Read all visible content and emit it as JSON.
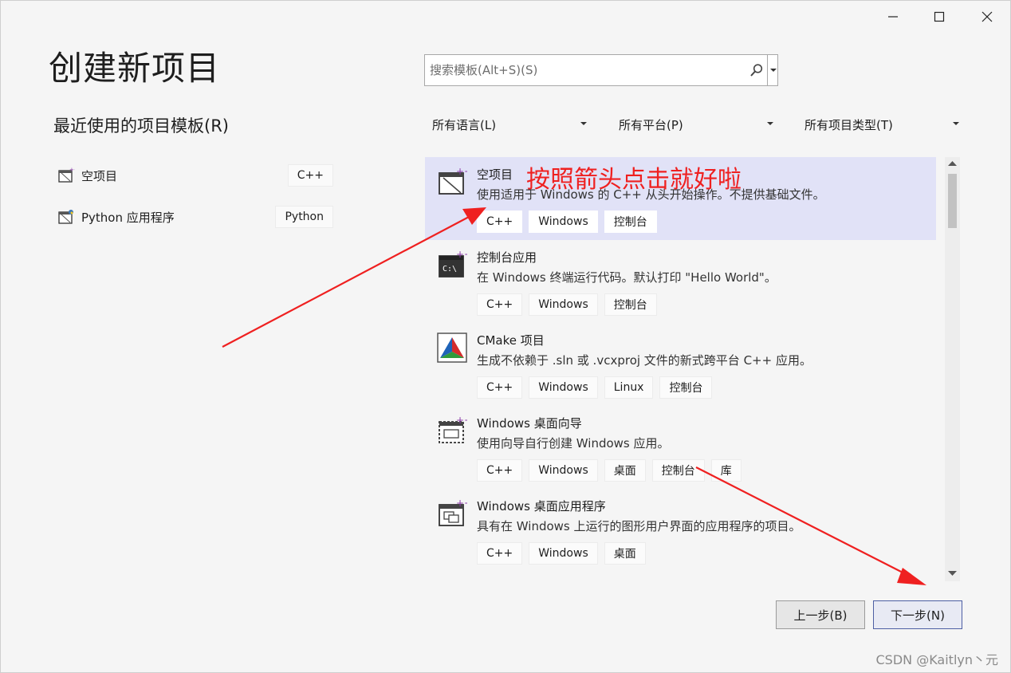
{
  "window": {
    "controls": [
      "minimize",
      "maximize",
      "close"
    ]
  },
  "page": {
    "title": "创建新项目"
  },
  "recent": {
    "title": "最近使用的项目模板(R)",
    "items": [
      {
        "label": "空项目",
        "tag": "C++",
        "icon": "empty-project-icon"
      },
      {
        "label": "Python 应用程序",
        "tag": "Python",
        "icon": "python-app-icon"
      }
    ]
  },
  "search": {
    "placeholder": "搜索模板(Alt+S)(S)",
    "value": ""
  },
  "filters": {
    "language": "所有语言(L)",
    "platform": "所有平台(P)",
    "project_type": "所有项目类型(T)"
  },
  "templates": [
    {
      "name": "空项目",
      "description": "使用适用于 Windows 的 C++ 从头开始操作。不提供基础文件。",
      "tags": [
        "C++",
        "Windows",
        "控制台"
      ],
      "icon": "empty-project-icon",
      "selected": true
    },
    {
      "name": "控制台应用",
      "description": "在 Windows 终端运行代码。默认打印 \"Hello World\"。",
      "tags": [
        "C++",
        "Windows",
        "控制台"
      ],
      "icon": "console-app-icon",
      "selected": false
    },
    {
      "name": "CMake 项目",
      "description": "生成不依赖于 .sln 或 .vcxproj 文件的新式跨平台 C++ 应用。",
      "tags": [
        "C++",
        "Windows",
        "Linux",
        "控制台"
      ],
      "icon": "cmake-icon",
      "selected": false
    },
    {
      "name": "Windows 桌面向导",
      "description": "使用向导自行创建 Windows 应用。",
      "tags": [
        "C++",
        "Windows",
        "桌面",
        "控制台",
        "库"
      ],
      "icon": "desktop-wizard-icon",
      "selected": false
    },
    {
      "name": "Windows 桌面应用程序",
      "description": "具有在 Windows 上运行的图形用户界面的应用程序的项目。",
      "tags": [
        "C++",
        "Windows",
        "桌面"
      ],
      "icon": "desktop-app-icon",
      "selected": false
    }
  ],
  "buttons": {
    "back": "上一步(B)",
    "next": "下一步(N)"
  },
  "annotation": {
    "text": "按照箭头点击就好啦",
    "color": "#ef2020"
  },
  "watermark": "CSDN @Kaitlyn丶元",
  "colors": {
    "selected_row": "#e1e2f7",
    "primary_border": "#4d5fa3",
    "arrow": "#ef2020"
  }
}
